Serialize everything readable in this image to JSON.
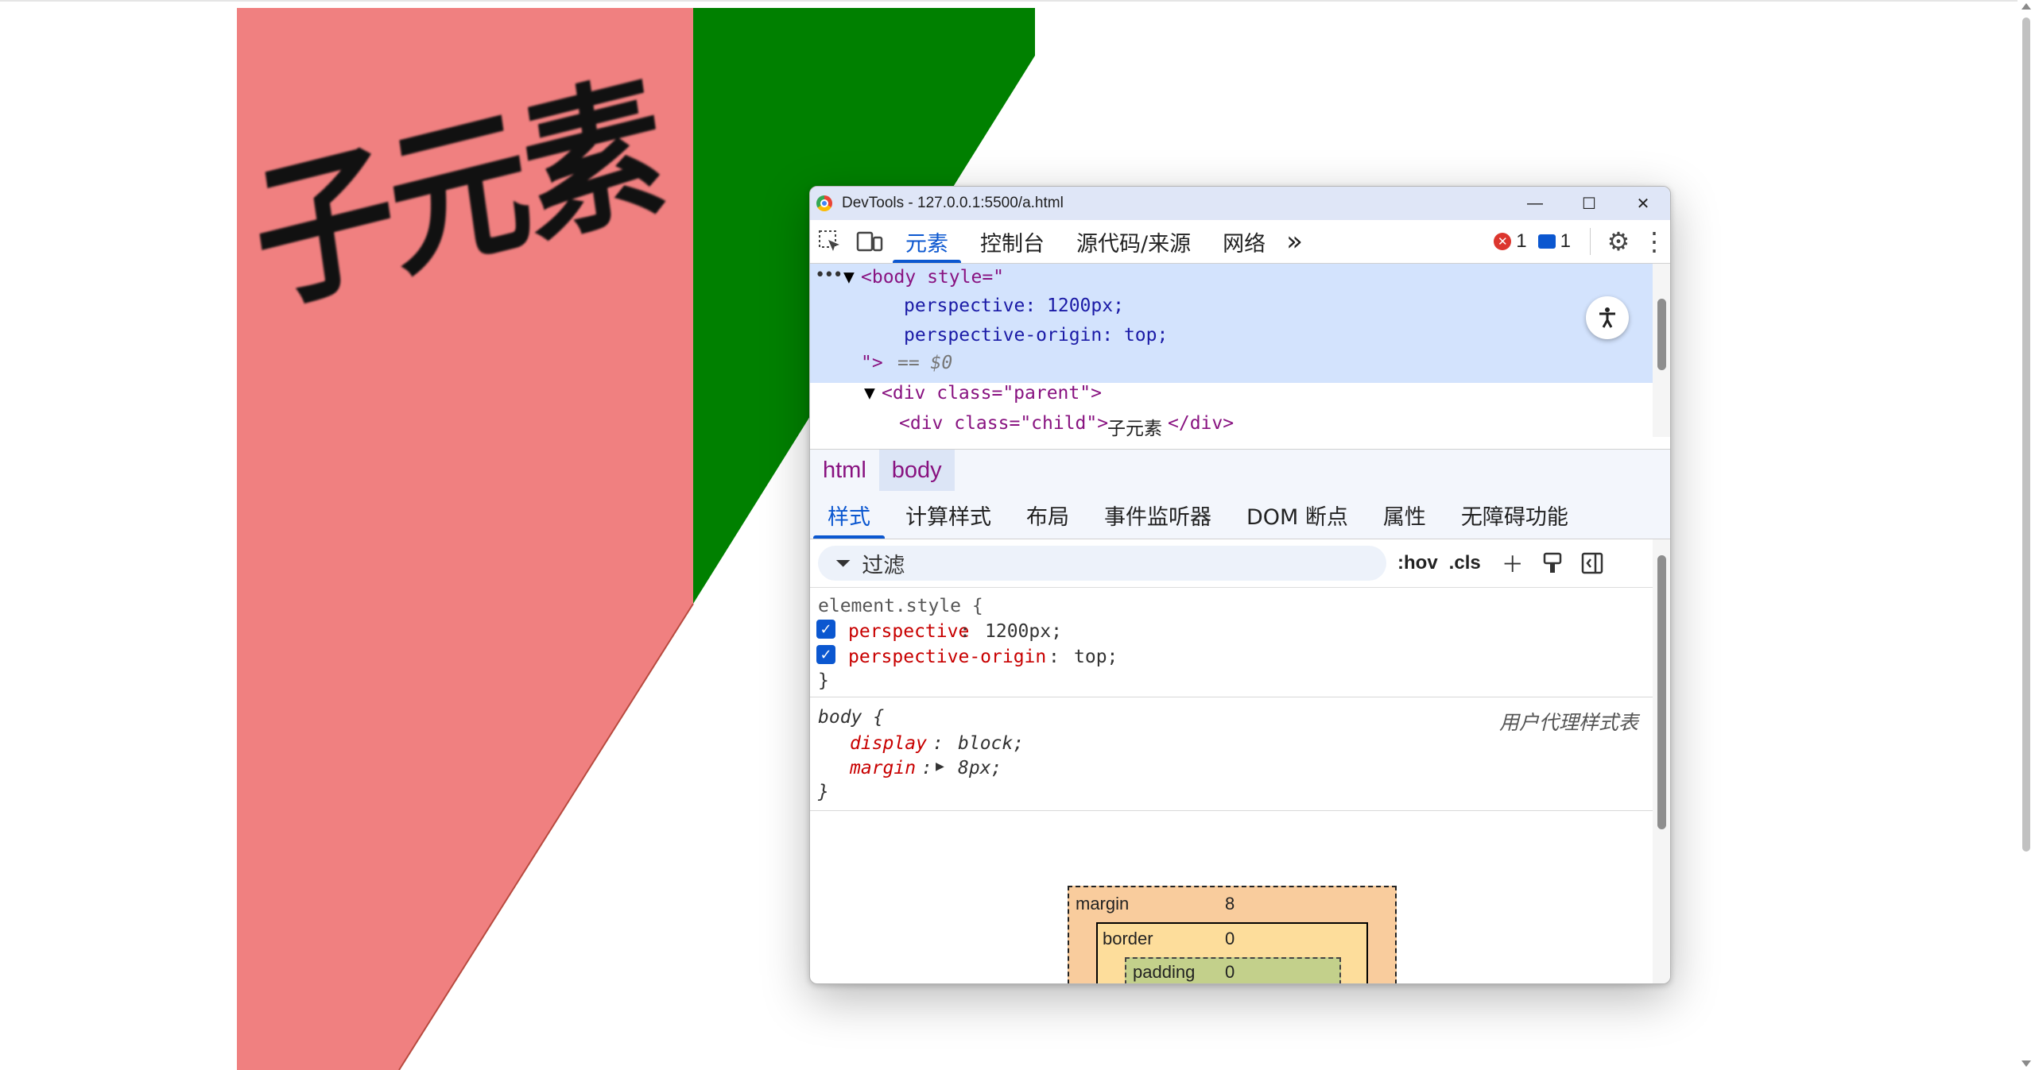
{
  "page": {
    "child_text": "子元素",
    "colors": {
      "parent": "#008000",
      "child": "#f08080"
    }
  },
  "devtools": {
    "title": "DevTools - 127.0.0.1:5500/a.html",
    "window_buttons": {
      "minimize": "—",
      "maximize": "☐",
      "close": "✕"
    },
    "tabs": [
      "元素",
      "控制台",
      "源代码/来源",
      "网络"
    ],
    "more_tabs": "»",
    "error_count": "1",
    "message_count": "1",
    "dom": {
      "ellipsis": "•••",
      "body_open": "<body style=\"",
      "body_prop1": "perspective: 1200px;",
      "body_prop2": "perspective-origin: top;",
      "body_close": "\">",
      "eq0": "== $0",
      "div_parent": "<div class=\"parent\">",
      "div_child_open": "<div class=\"child\">",
      "div_child_text": "子元素",
      "div_child_close": "</div>"
    },
    "breadcrumbs": [
      "html",
      "body"
    ],
    "subtabs": [
      "样式",
      "计算样式",
      "布局",
      "事件监听器",
      "DOM 断点",
      "属性",
      "无障碍功能"
    ],
    "filter": {
      "placeholder": "过滤",
      "hov": ":hov",
      "cls": ".cls"
    },
    "styles": {
      "element_style": "element.style {",
      "rule1_prop": "perspective",
      "rule1_val": "1200px;",
      "rule2_prop": "perspective-origin",
      "rule2_val": "top;",
      "close": "}",
      "body_selector": "body {",
      "ua_label": "用户代理样式表",
      "display_prop": "display",
      "display_val": "block;",
      "margin_prop": "margin",
      "margin_val": "8px;"
    },
    "box_model": {
      "margin_label": "margin",
      "margin_val": "8",
      "border_label": "border",
      "border_val": "0",
      "padding_label": "padding",
      "padding_val": "0"
    }
  }
}
